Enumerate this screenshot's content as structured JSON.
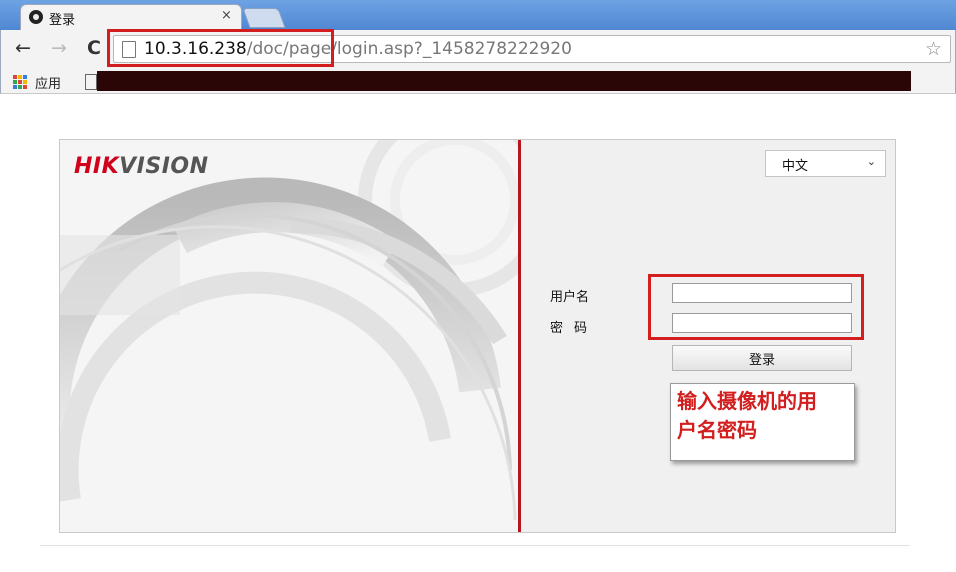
{
  "browser": {
    "tab_title": "登录",
    "tab_close": "×",
    "url_host": "10.3.16.238",
    "url_path": "/doc/page/login.asp?_1458278222920",
    "apps_label": "应用"
  },
  "nav": {
    "back": "←",
    "forward": "→",
    "reload": "C",
    "star": "☆"
  },
  "brand": {
    "part1": "HIK",
    "part2": "VISION"
  },
  "login": {
    "language": "中文",
    "language_caret": "⌄",
    "username_label": "用户名",
    "password_label": "密码",
    "username_value": "",
    "password_value": "",
    "submit_label": "登录"
  },
  "annotation": {
    "line1": "输入摄像机的用",
    "line2": "户名密码"
  },
  "colors": {
    "accent_red": "#d21e1e",
    "divider_red": "#b7161d",
    "titlebar_blue": "#5b93db"
  },
  "icons": {
    "tab_favicon": "hikvision-favicon",
    "page": "page-icon",
    "apps": "apps-grid-icon",
    "star": "bookmark-star-icon",
    "folder": "bookmark-folder-icon"
  }
}
